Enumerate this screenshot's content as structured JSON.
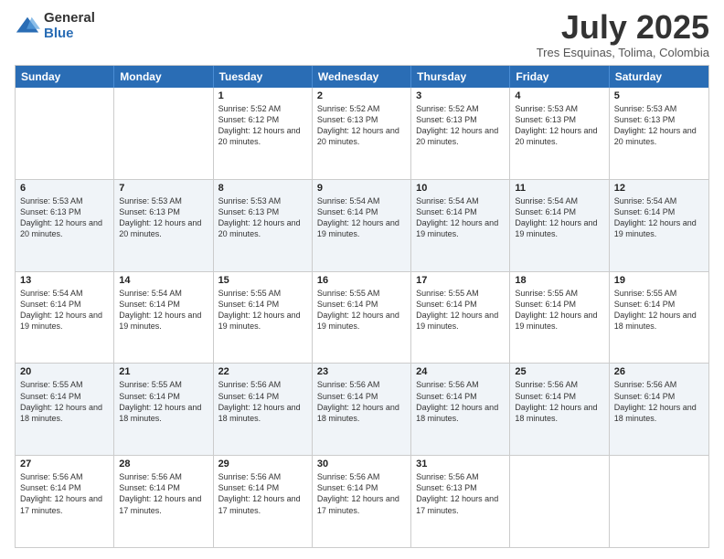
{
  "logo": {
    "general": "General",
    "blue": "Blue"
  },
  "header": {
    "month": "July 2025",
    "location": "Tres Esquinas, Tolima, Colombia"
  },
  "weekdays": [
    "Sunday",
    "Monday",
    "Tuesday",
    "Wednesday",
    "Thursday",
    "Friday",
    "Saturday"
  ],
  "rows": [
    {
      "alt": false,
      "cells": [
        {
          "day": "",
          "sunrise": "",
          "sunset": "",
          "daylight": ""
        },
        {
          "day": "",
          "sunrise": "",
          "sunset": "",
          "daylight": ""
        },
        {
          "day": "1",
          "sunrise": "Sunrise: 5:52 AM",
          "sunset": "Sunset: 6:12 PM",
          "daylight": "Daylight: 12 hours and 20 minutes."
        },
        {
          "day": "2",
          "sunrise": "Sunrise: 5:52 AM",
          "sunset": "Sunset: 6:13 PM",
          "daylight": "Daylight: 12 hours and 20 minutes."
        },
        {
          "day": "3",
          "sunrise": "Sunrise: 5:52 AM",
          "sunset": "Sunset: 6:13 PM",
          "daylight": "Daylight: 12 hours and 20 minutes."
        },
        {
          "day": "4",
          "sunrise": "Sunrise: 5:53 AM",
          "sunset": "Sunset: 6:13 PM",
          "daylight": "Daylight: 12 hours and 20 minutes."
        },
        {
          "day": "5",
          "sunrise": "Sunrise: 5:53 AM",
          "sunset": "Sunset: 6:13 PM",
          "daylight": "Daylight: 12 hours and 20 minutes."
        }
      ]
    },
    {
      "alt": true,
      "cells": [
        {
          "day": "6",
          "sunrise": "Sunrise: 5:53 AM",
          "sunset": "Sunset: 6:13 PM",
          "daylight": "Daylight: 12 hours and 20 minutes."
        },
        {
          "day": "7",
          "sunrise": "Sunrise: 5:53 AM",
          "sunset": "Sunset: 6:13 PM",
          "daylight": "Daylight: 12 hours and 20 minutes."
        },
        {
          "day": "8",
          "sunrise": "Sunrise: 5:53 AM",
          "sunset": "Sunset: 6:13 PM",
          "daylight": "Daylight: 12 hours and 20 minutes."
        },
        {
          "day": "9",
          "sunrise": "Sunrise: 5:54 AM",
          "sunset": "Sunset: 6:14 PM",
          "daylight": "Daylight: 12 hours and 19 minutes."
        },
        {
          "day": "10",
          "sunrise": "Sunrise: 5:54 AM",
          "sunset": "Sunset: 6:14 PM",
          "daylight": "Daylight: 12 hours and 19 minutes."
        },
        {
          "day": "11",
          "sunrise": "Sunrise: 5:54 AM",
          "sunset": "Sunset: 6:14 PM",
          "daylight": "Daylight: 12 hours and 19 minutes."
        },
        {
          "day": "12",
          "sunrise": "Sunrise: 5:54 AM",
          "sunset": "Sunset: 6:14 PM",
          "daylight": "Daylight: 12 hours and 19 minutes."
        }
      ]
    },
    {
      "alt": false,
      "cells": [
        {
          "day": "13",
          "sunrise": "Sunrise: 5:54 AM",
          "sunset": "Sunset: 6:14 PM",
          "daylight": "Daylight: 12 hours and 19 minutes."
        },
        {
          "day": "14",
          "sunrise": "Sunrise: 5:54 AM",
          "sunset": "Sunset: 6:14 PM",
          "daylight": "Daylight: 12 hours and 19 minutes."
        },
        {
          "day": "15",
          "sunrise": "Sunrise: 5:55 AM",
          "sunset": "Sunset: 6:14 PM",
          "daylight": "Daylight: 12 hours and 19 minutes."
        },
        {
          "day": "16",
          "sunrise": "Sunrise: 5:55 AM",
          "sunset": "Sunset: 6:14 PM",
          "daylight": "Daylight: 12 hours and 19 minutes."
        },
        {
          "day": "17",
          "sunrise": "Sunrise: 5:55 AM",
          "sunset": "Sunset: 6:14 PM",
          "daylight": "Daylight: 12 hours and 19 minutes."
        },
        {
          "day": "18",
          "sunrise": "Sunrise: 5:55 AM",
          "sunset": "Sunset: 6:14 PM",
          "daylight": "Daylight: 12 hours and 19 minutes."
        },
        {
          "day": "19",
          "sunrise": "Sunrise: 5:55 AM",
          "sunset": "Sunset: 6:14 PM",
          "daylight": "Daylight: 12 hours and 18 minutes."
        }
      ]
    },
    {
      "alt": true,
      "cells": [
        {
          "day": "20",
          "sunrise": "Sunrise: 5:55 AM",
          "sunset": "Sunset: 6:14 PM",
          "daylight": "Daylight: 12 hours and 18 minutes."
        },
        {
          "day": "21",
          "sunrise": "Sunrise: 5:55 AM",
          "sunset": "Sunset: 6:14 PM",
          "daylight": "Daylight: 12 hours and 18 minutes."
        },
        {
          "day": "22",
          "sunrise": "Sunrise: 5:56 AM",
          "sunset": "Sunset: 6:14 PM",
          "daylight": "Daylight: 12 hours and 18 minutes."
        },
        {
          "day": "23",
          "sunrise": "Sunrise: 5:56 AM",
          "sunset": "Sunset: 6:14 PM",
          "daylight": "Daylight: 12 hours and 18 minutes."
        },
        {
          "day": "24",
          "sunrise": "Sunrise: 5:56 AM",
          "sunset": "Sunset: 6:14 PM",
          "daylight": "Daylight: 12 hours and 18 minutes."
        },
        {
          "day": "25",
          "sunrise": "Sunrise: 5:56 AM",
          "sunset": "Sunset: 6:14 PM",
          "daylight": "Daylight: 12 hours and 18 minutes."
        },
        {
          "day": "26",
          "sunrise": "Sunrise: 5:56 AM",
          "sunset": "Sunset: 6:14 PM",
          "daylight": "Daylight: 12 hours and 18 minutes."
        }
      ]
    },
    {
      "alt": false,
      "cells": [
        {
          "day": "27",
          "sunrise": "Sunrise: 5:56 AM",
          "sunset": "Sunset: 6:14 PM",
          "daylight": "Daylight: 12 hours and 17 minutes."
        },
        {
          "day": "28",
          "sunrise": "Sunrise: 5:56 AM",
          "sunset": "Sunset: 6:14 PM",
          "daylight": "Daylight: 12 hours and 17 minutes."
        },
        {
          "day": "29",
          "sunrise": "Sunrise: 5:56 AM",
          "sunset": "Sunset: 6:14 PM",
          "daylight": "Daylight: 12 hours and 17 minutes."
        },
        {
          "day": "30",
          "sunrise": "Sunrise: 5:56 AM",
          "sunset": "Sunset: 6:14 PM",
          "daylight": "Daylight: 12 hours and 17 minutes."
        },
        {
          "day": "31",
          "sunrise": "Sunrise: 5:56 AM",
          "sunset": "Sunset: 6:13 PM",
          "daylight": "Daylight: 12 hours and 17 minutes."
        },
        {
          "day": "",
          "sunrise": "",
          "sunset": "",
          "daylight": ""
        },
        {
          "day": "",
          "sunrise": "",
          "sunset": "",
          "daylight": ""
        }
      ]
    }
  ]
}
